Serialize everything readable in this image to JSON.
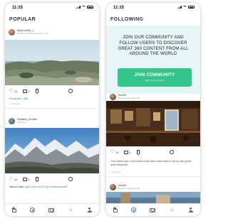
{
  "left_screen": {
    "status_time": "11:15",
    "section_title": "POPULAR",
    "posts": [
      {
        "user": "Manxolotis_1",
        "location": "Goodbye-the-Good Reserve, NV",
        "likes": "16",
        "comments": "3",
        "caption": "#Solpaiiin_360",
        "time_ago": "4 days ago"
      },
      {
        "user": "Stealthy_Erubin",
        "location": "unknown",
        "likes": "16",
        "comments": "4",
        "caption_user": "Island Lake",
        "caption_tags": "#go tripvw #400 #photowhatsstuff"
      }
    ]
  },
  "right_screen": {
    "status_time": "11:15",
    "section_title": "FOLLOWING",
    "join_banner": {
      "text": "JOIN OUR COMMUNITY AND FOLLOW USERS TO DISCOVER GREAT 360 CONTENT FROM ALL AROUND THE WORLD",
      "button_label": "JOIN COMMUNITY",
      "button_sub": "Sign up and connect"
    },
    "posts": [
      {
        "user": "Inhnet",
        "location": "Brussels, Brussels, BE",
        "likes": "16",
        "comments": "4",
        "caption": "The oldest bar in Brussels that was frequented a lot by the great artist Magritte.",
        "time_ago": "3 days ago"
      },
      {
        "user": "Inhnet",
        "location": "Brussels, Brussels, BE"
      }
    ]
  },
  "tab_bar": {
    "left_active": "trending",
    "right_active": "explore",
    "items": [
      "home-icon",
      "compass-icon",
      "camera-icon",
      "fire-icon",
      "profile-icon"
    ]
  },
  "colors": {
    "accent": "#2a8fb8",
    "join_button": "#35c58c",
    "banner_bg": "#e6f4f6"
  }
}
